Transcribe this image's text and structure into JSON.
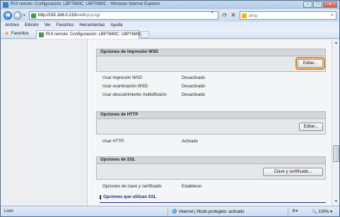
{
  "window": {
    "title": "RUI remoto: Configuración: LBP7680C: LBP7680C - Windows Internet Explorer",
    "controls": [
      "–",
      "□",
      "x"
    ]
  },
  "addressbar": {
    "url_host": "http://192.168.0.215/",
    "url_path": "netticp.p.cgi",
    "search_placeholder": "Bing"
  },
  "menu": [
    "Archivo",
    "Edición",
    "Ver",
    "Favoritos",
    "Herramientas",
    "Ayuda"
  ],
  "favorites": {
    "label": "Favoritos",
    "tab_title": "RUI remoto: Configuración: LBP7680C: LBP7680C"
  },
  "sections": {
    "wsd": {
      "title": "Opciones de impresión WSD",
      "edit_label": "Editar...",
      "rows": [
        {
          "label": "Usar impresión WSD:",
          "value": "Desactivado"
        },
        {
          "label": "Usar examinación WSD:",
          "value": "Desactivado"
        },
        {
          "label": "Usar descubrimiento multidifusión:",
          "value": "Desactivado"
        }
      ]
    },
    "http": {
      "title": "Opciones de HTTP",
      "edit_label": "Editar...",
      "rows": [
        {
          "label": "Usar HTTP:",
          "value": "Activado"
        }
      ]
    },
    "ssl": {
      "title": "Opciones de SSL",
      "button_label": "Clave y certificado...",
      "rows": [
        {
          "label": "Opciones de clave y certificado:",
          "value": "Establecer."
        }
      ],
      "subheading": "Opciones que utilizan SSL"
    }
  },
  "statusbar": {
    "status": "Listo",
    "zone": "Internet | Modo protegido: activado",
    "zoom": "100%"
  },
  "colors": {
    "highlight": "#e8820c",
    "section_header": "#d4d6d9",
    "subheading": "#1f2f6b"
  }
}
